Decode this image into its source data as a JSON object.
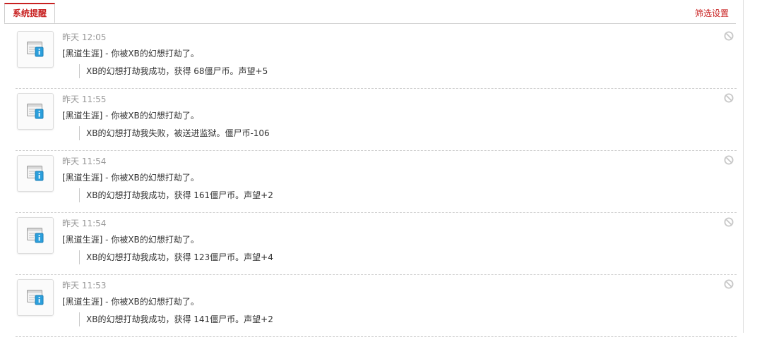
{
  "tabs": {
    "active_label": "系统提醒",
    "filter_label": "筛选设置"
  },
  "colors": {
    "accent": "#c82020",
    "muted": "#999999",
    "icon_blue": "#2b9fdc"
  },
  "notifications": [
    {
      "time": "昨天 12:05",
      "title": "[黑道生涯] - 你被XB的幻想打劫了。",
      "detail": "XB的幻想打劫我成功，获得 68僵尸币。声望+5",
      "icon": "info-window-icon"
    },
    {
      "time": "昨天 11:55",
      "title": "[黑道生涯] - 你被XB的幻想打劫了。",
      "detail": "XB的幻想打劫我失败，被送进监狱。僵尸币-106",
      "icon": "info-window-icon"
    },
    {
      "time": "昨天 11:54",
      "title": "[黑道生涯] - 你被XB的幻想打劫了。",
      "detail": "XB的幻想打劫我成功，获得 161僵尸币。声望+2",
      "icon": "info-window-icon"
    },
    {
      "time": "昨天 11:54",
      "title": "[黑道生涯] - 你被XB的幻想打劫了。",
      "detail": "XB的幻想打劫我成功，获得 123僵尸币。声望+4",
      "icon": "info-window-icon"
    },
    {
      "time": "昨天 11:53",
      "title": "[黑道生涯] - 你被XB的幻想打劫了。",
      "detail": "XB的幻想打劫我成功，获得 141僵尸币。声望+2",
      "icon": "info-window-icon"
    }
  ]
}
